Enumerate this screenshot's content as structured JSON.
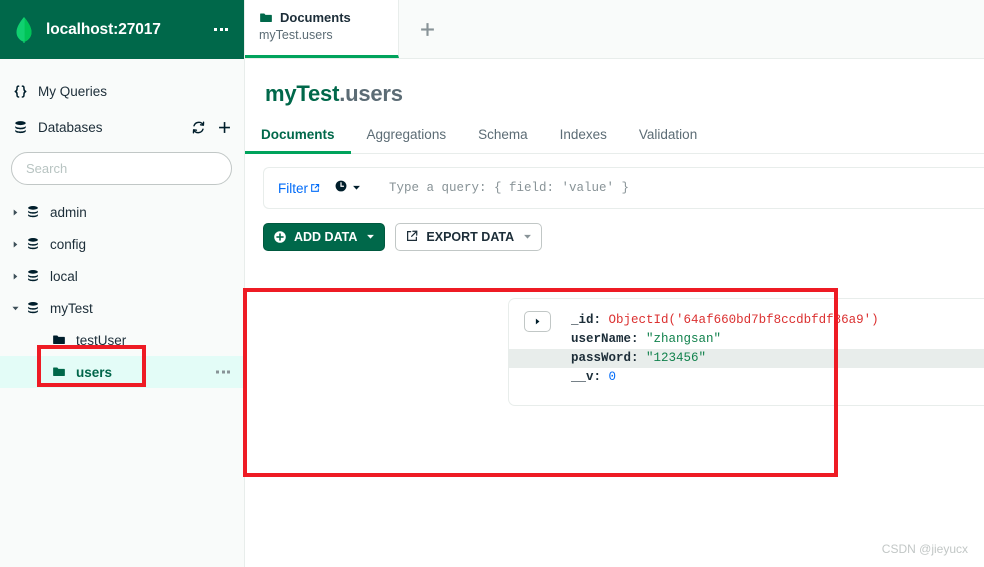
{
  "connection": {
    "title": "localhost:27017",
    "logo_icon": "mongodb-leaf-icon",
    "menu_icon": "ellipsis-icon"
  },
  "sidebar": {
    "my_queries": {
      "label": "My Queries",
      "icon": "curly-braces-icon"
    },
    "databases": {
      "label": "Databases",
      "icon": "database-icon",
      "refresh_icon": "refresh-icon",
      "add_icon": "plus-icon"
    },
    "search": {
      "placeholder": "Search",
      "value": ""
    },
    "databases_list": [
      {
        "name": "admin",
        "icon": "database-icon",
        "expanded": false,
        "selected": false
      },
      {
        "name": "config",
        "icon": "database-icon",
        "expanded": false,
        "selected": false
      },
      {
        "name": "local",
        "icon": "database-icon",
        "expanded": false,
        "selected": false
      },
      {
        "name": "myTest",
        "icon": "database-icon",
        "expanded": true,
        "selected": false
      }
    ],
    "collections": [
      {
        "name": "testUser",
        "icon": "folder-icon",
        "selected": false
      },
      {
        "name": "users",
        "icon": "folder-icon",
        "selected": true,
        "menu_icon": "ellipsis-icon"
      }
    ]
  },
  "tab_strip": {
    "tabs": [
      {
        "title": "Documents",
        "subtitle": "myTest.users",
        "icon": "folder-icon",
        "active": true
      }
    ],
    "new_tab_icon": "plus-icon"
  },
  "collection": {
    "namespace_db": "myTest",
    "namespace_separator": ".",
    "namespace_collection": "users",
    "tabs": [
      {
        "label": "Documents",
        "active": true
      },
      {
        "label": "Aggregations",
        "active": false
      },
      {
        "label": "Schema",
        "active": false
      },
      {
        "label": "Indexes",
        "active": false
      },
      {
        "label": "Validation",
        "active": false
      }
    ]
  },
  "query_bar": {
    "filter_label": "Filter",
    "filter_external_icon": "external-link-icon",
    "history_icon": "clock-icon",
    "history_caret_icon": "chevron-down-icon",
    "placeholder": "Type a query: { field: 'value' }",
    "value": ""
  },
  "actions": {
    "add_data": {
      "label": "ADD DATA",
      "icon": "plus-circle-icon",
      "caret_icon": "chevron-down-icon"
    },
    "export_data": {
      "label": "EXPORT DATA",
      "icon": "export-icon",
      "caret_icon": "chevron-down-icon"
    }
  },
  "document": {
    "expand_icon": "triangle-right-icon",
    "fields": [
      {
        "key": "_id",
        "value": "ObjectId('64af660bd7bf8ccdbfdf86a9')",
        "type": "objectid",
        "highlighted": false
      },
      {
        "key": "userName",
        "value": "\"zhangsan\"",
        "type": "string",
        "highlighted": false
      },
      {
        "key": "passWord",
        "value": "\"123456\"",
        "type": "string",
        "highlighted": true
      },
      {
        "key": "__v",
        "value": "0",
        "type": "number",
        "highlighted": false
      }
    ]
  },
  "annotations": {
    "document_box_color": "#ee1b24",
    "users_box_color": "#ee1b24"
  },
  "watermark": {
    "text": "CSDN @jieyucx"
  },
  "colors": {
    "header_green": "#00684a",
    "accent_green": "#00a35c",
    "selected_row": "#e3fcf7",
    "link_blue": "#016bf8",
    "string_green": "#12824d",
    "objectid_red": "#db3030",
    "number_blue": "#016bf8"
  }
}
